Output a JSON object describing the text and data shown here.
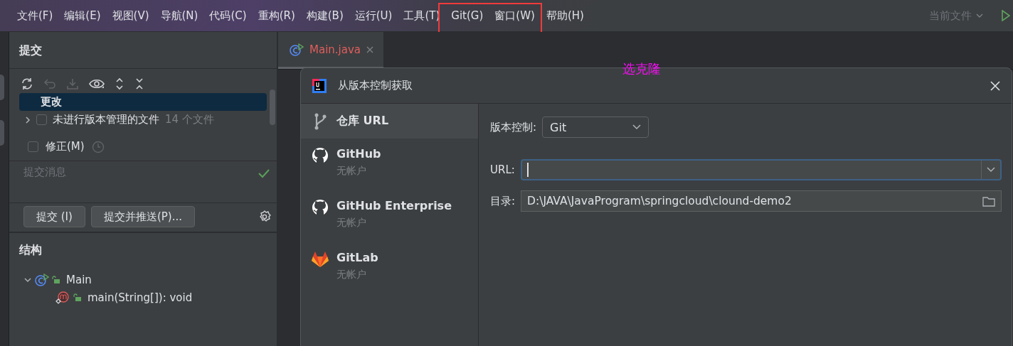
{
  "menu": [
    {
      "label": "文件(F)"
    },
    {
      "label": "编辑(E)"
    },
    {
      "label": "视图(V)"
    },
    {
      "label": "导航(N)"
    },
    {
      "label": "代码(C)"
    },
    {
      "label": "重构(R)"
    },
    {
      "label": "构建(B)"
    },
    {
      "label": "运行(U)"
    },
    {
      "label": "工具(T)"
    },
    {
      "label": "Git(G)"
    },
    {
      "label": "窗口(W)"
    },
    {
      "label": "帮助(H)"
    }
  ],
  "run_config": {
    "label": "当前文件"
  },
  "annotation": {
    "text": "选克隆"
  },
  "commit_panel": {
    "title": "提交",
    "changes": [
      {
        "kind": "group",
        "label": "更改",
        "selected": true
      },
      {
        "kind": "folder",
        "label": "未进行版本管理的文件",
        "count": "14 个文件",
        "checked": false,
        "selected": false
      }
    ],
    "amend": {
      "label": "修正(M)",
      "checked": false
    },
    "message": {
      "placeholder": "提交消息"
    },
    "buttons": [
      "提交 (I)",
      "提交并推送(P)..."
    ]
  },
  "structure": {
    "title": "结构",
    "tree": [
      {
        "label": "Main",
        "kind": "class",
        "expanded": true,
        "children": [
          {
            "label": "main(String[]): void",
            "kind": "method"
          }
        ]
      }
    ]
  },
  "editor": {
    "tabs": [
      {
        "label": "Main.java",
        "selected": true
      }
    ]
  },
  "dialog": {
    "title": "从版本控制获取",
    "sources": [
      {
        "kind": "url",
        "label": "仓库 URL",
        "selected": true
      },
      {
        "kind": "github",
        "label": "GitHub",
        "subtitle": "无帐户",
        "selected": false
      },
      {
        "kind": "github",
        "label": "GitHub Enterprise",
        "subtitle": "无帐户",
        "selected": false
      },
      {
        "kind": "gitlab",
        "label": "GitLab",
        "subtitle": "无帐户",
        "selected": false
      }
    ],
    "vcs": {
      "label": "版本控制:",
      "value": "Git"
    },
    "url": {
      "label": "URL:"
    },
    "directory": {
      "label": "目录:",
      "value": "D:\\JAVA\\JavaProgram\\springcloud\\clound-demo2"
    }
  }
}
